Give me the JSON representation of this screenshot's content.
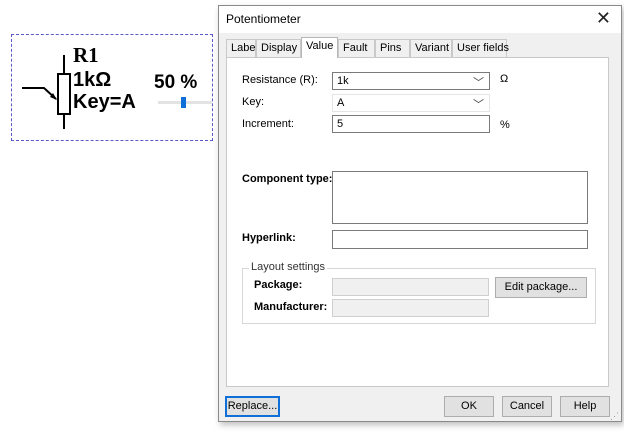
{
  "schematic": {
    "designator": "R1",
    "value": "1kΩ",
    "key": "Key=A",
    "percent": "50 %",
    "slider_position": 0.5
  },
  "dialog": {
    "title": "Potentiometer",
    "tabs": [
      {
        "label": "Label"
      },
      {
        "label": "Display"
      },
      {
        "label": "Value",
        "active": true
      },
      {
        "label": "Fault"
      },
      {
        "label": "Pins"
      },
      {
        "label": "Variant"
      },
      {
        "label": "User fields"
      }
    ],
    "fields": {
      "resistance": {
        "label": "Resistance (R):",
        "value": "1k",
        "unit": "Ω"
      },
      "key": {
        "label": "Key:",
        "value": "A"
      },
      "increment": {
        "label": "Increment:",
        "value": "5",
        "unit": "%"
      },
      "component_type": {
        "label": "Component type:",
        "value": ""
      },
      "hyperlink": {
        "label": "Hyperlink:",
        "value": ""
      }
    },
    "layout_settings": {
      "title": "Layout settings",
      "package_label": "Package:",
      "package_value": "",
      "manufacturer_label": "Manufacturer:",
      "manufacturer_value": "",
      "edit_package_button": "Edit package..."
    },
    "buttons": {
      "replace": "Replace...",
      "ok": "OK",
      "cancel": "Cancel",
      "help": "Help"
    }
  }
}
